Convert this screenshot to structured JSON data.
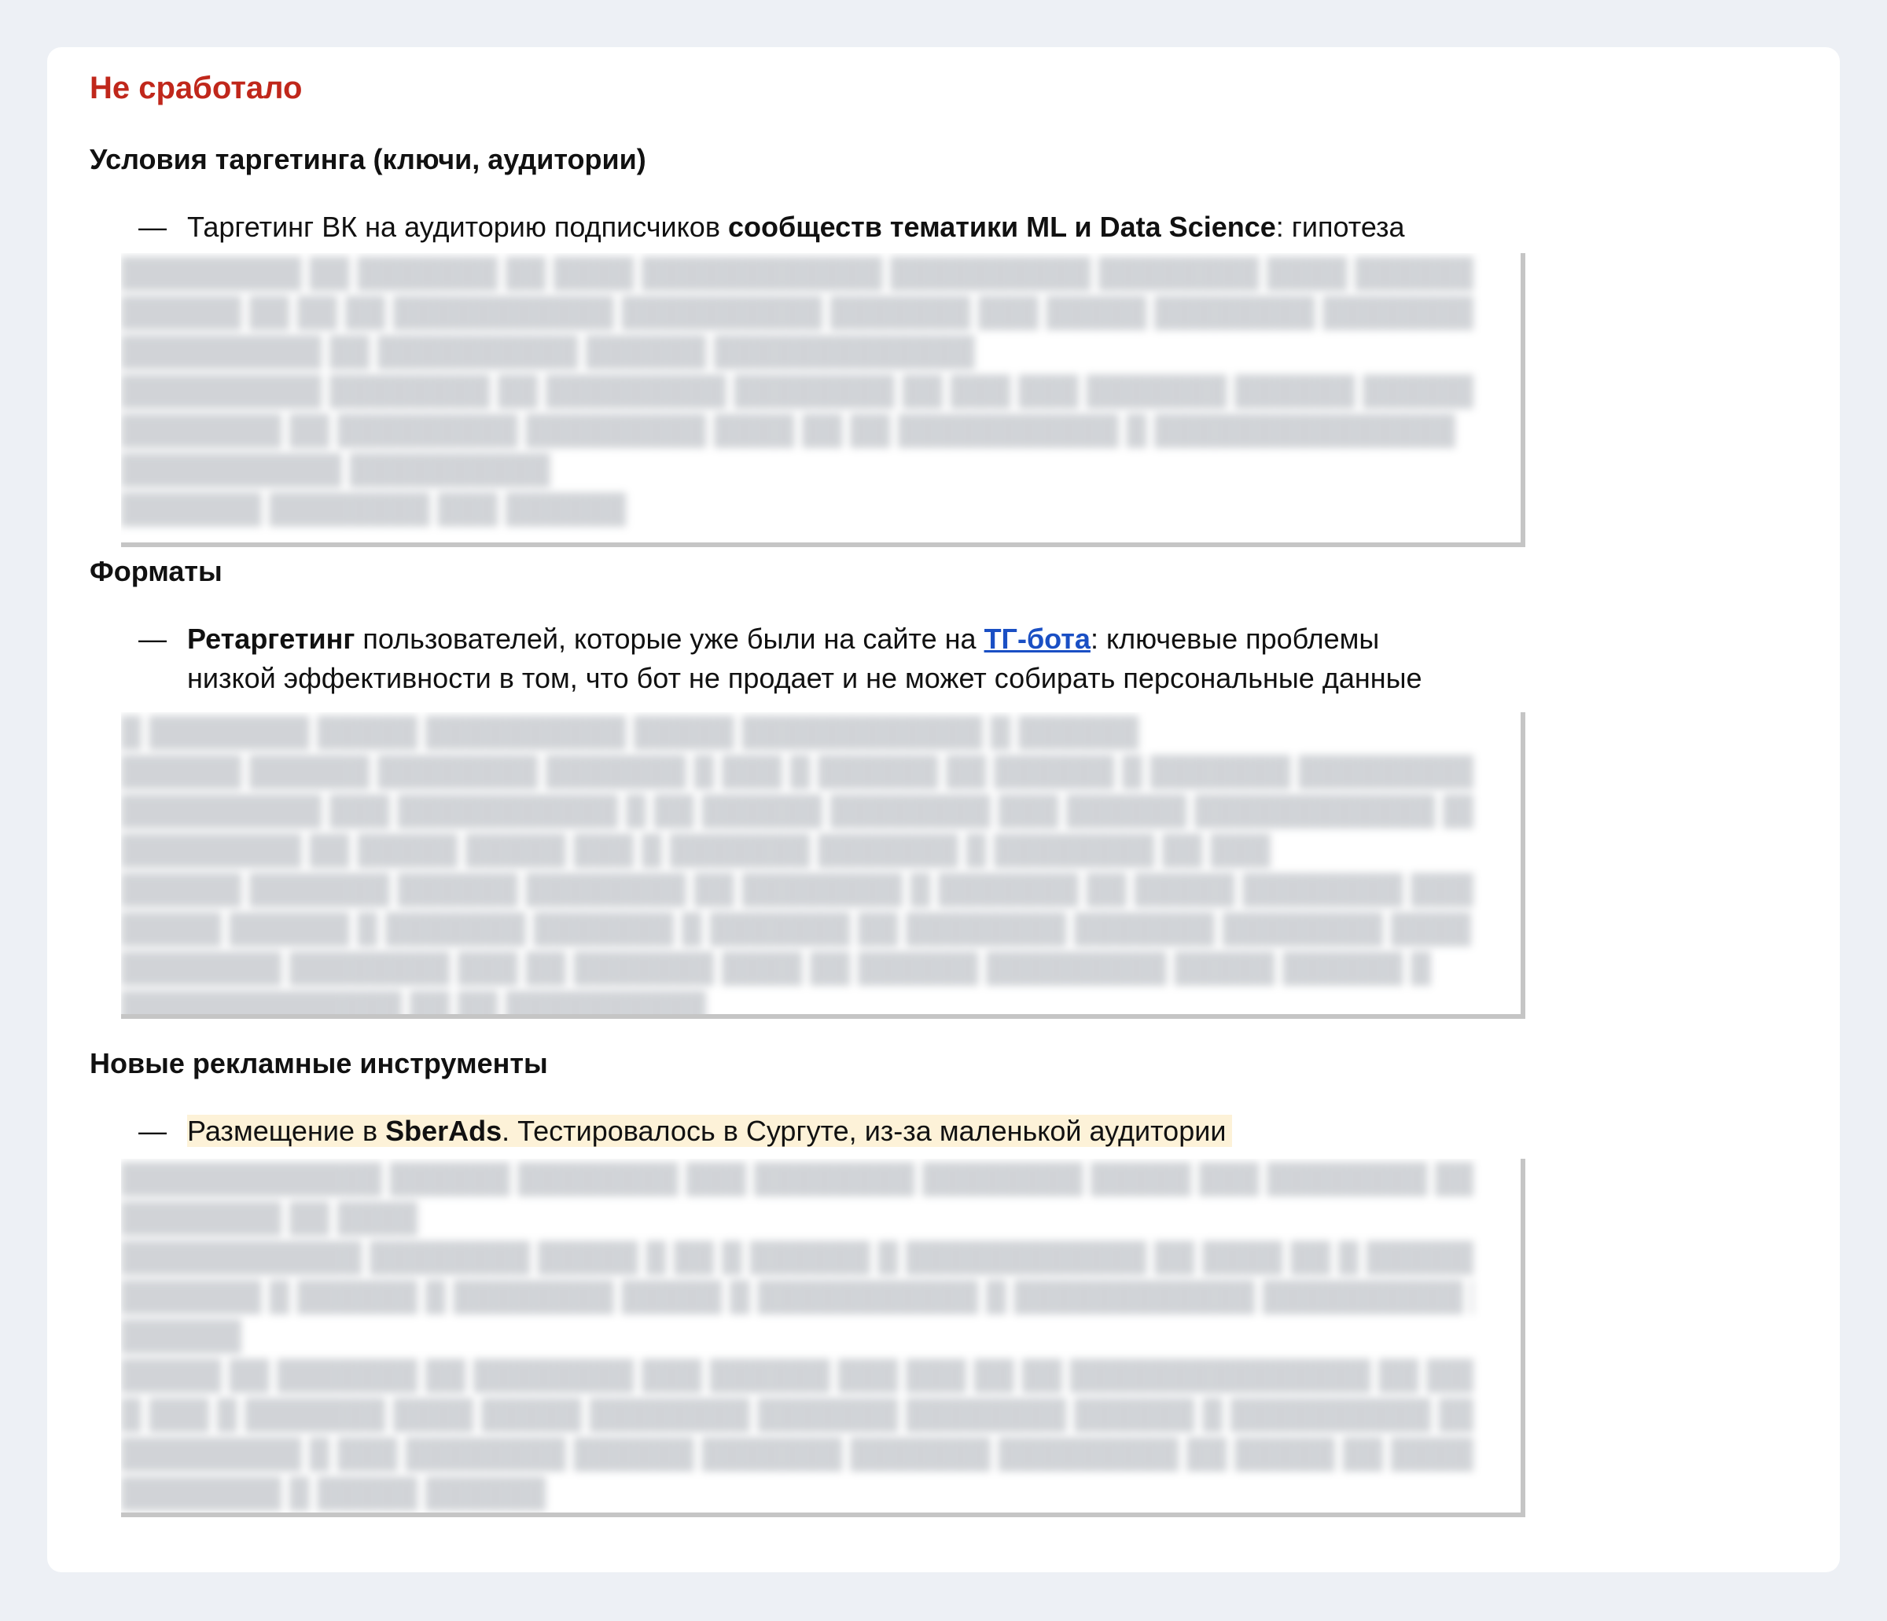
{
  "status_title": "Не сработало",
  "sections": [
    {
      "heading": "Условия таргетинга (ключи, аудитории)",
      "item": {
        "dash": "—",
        "text_before": "Таргетинг ВК на аудиторию подписчиков ",
        "bold": "сообществ тематики ML и Data Science",
        "text_after": ": гипотеза"
      }
    },
    {
      "heading": "Форматы",
      "item": {
        "dash": "—",
        "bold": "Ретаргетинг",
        "text_before": " пользователей, которые уже были на сайте на ",
        "link": "ТГ-бота",
        "text_after": ": ключевые проблемы",
        "line2": "низкой эффективности в том, что бот не продает и не может собирать персональные данные"
      }
    },
    {
      "heading": "Новые рекламные инструменты",
      "item": {
        "dash": "—",
        "text_before": "Размещение в ",
        "bold": "SberAds",
        "text_after": ". Тестировалось в Сургуте, из-за маленькой аудитории"
      }
    }
  ]
}
